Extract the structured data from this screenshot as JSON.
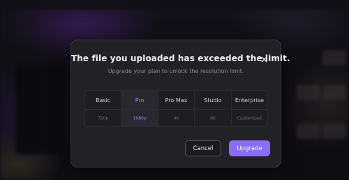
{
  "modal": {
    "title": "The file you uploaded has exceeded the limit.",
    "subtitle": "Upgrade your plan to unlock the resolution limit.",
    "close_icon": "close-icon",
    "plans": [
      {
        "name": "Basic",
        "resolution": "720p",
        "active": false
      },
      {
        "name": "Pro",
        "resolution": "1080p",
        "active": true
      },
      {
        "name": "Pro Max",
        "resolution": "4K",
        "active": false
      },
      {
        "name": "Studio",
        "resolution": "8K",
        "active": false
      },
      {
        "name": "Enterprise",
        "resolution": "Customized",
        "active": false
      }
    ],
    "cancel_label": "Cancel",
    "upgrade_label": "Upgrade"
  },
  "colors": {
    "accent": "#8a6cf5",
    "highlight_text": "#9f86f7",
    "modal_bg": "#222126"
  }
}
